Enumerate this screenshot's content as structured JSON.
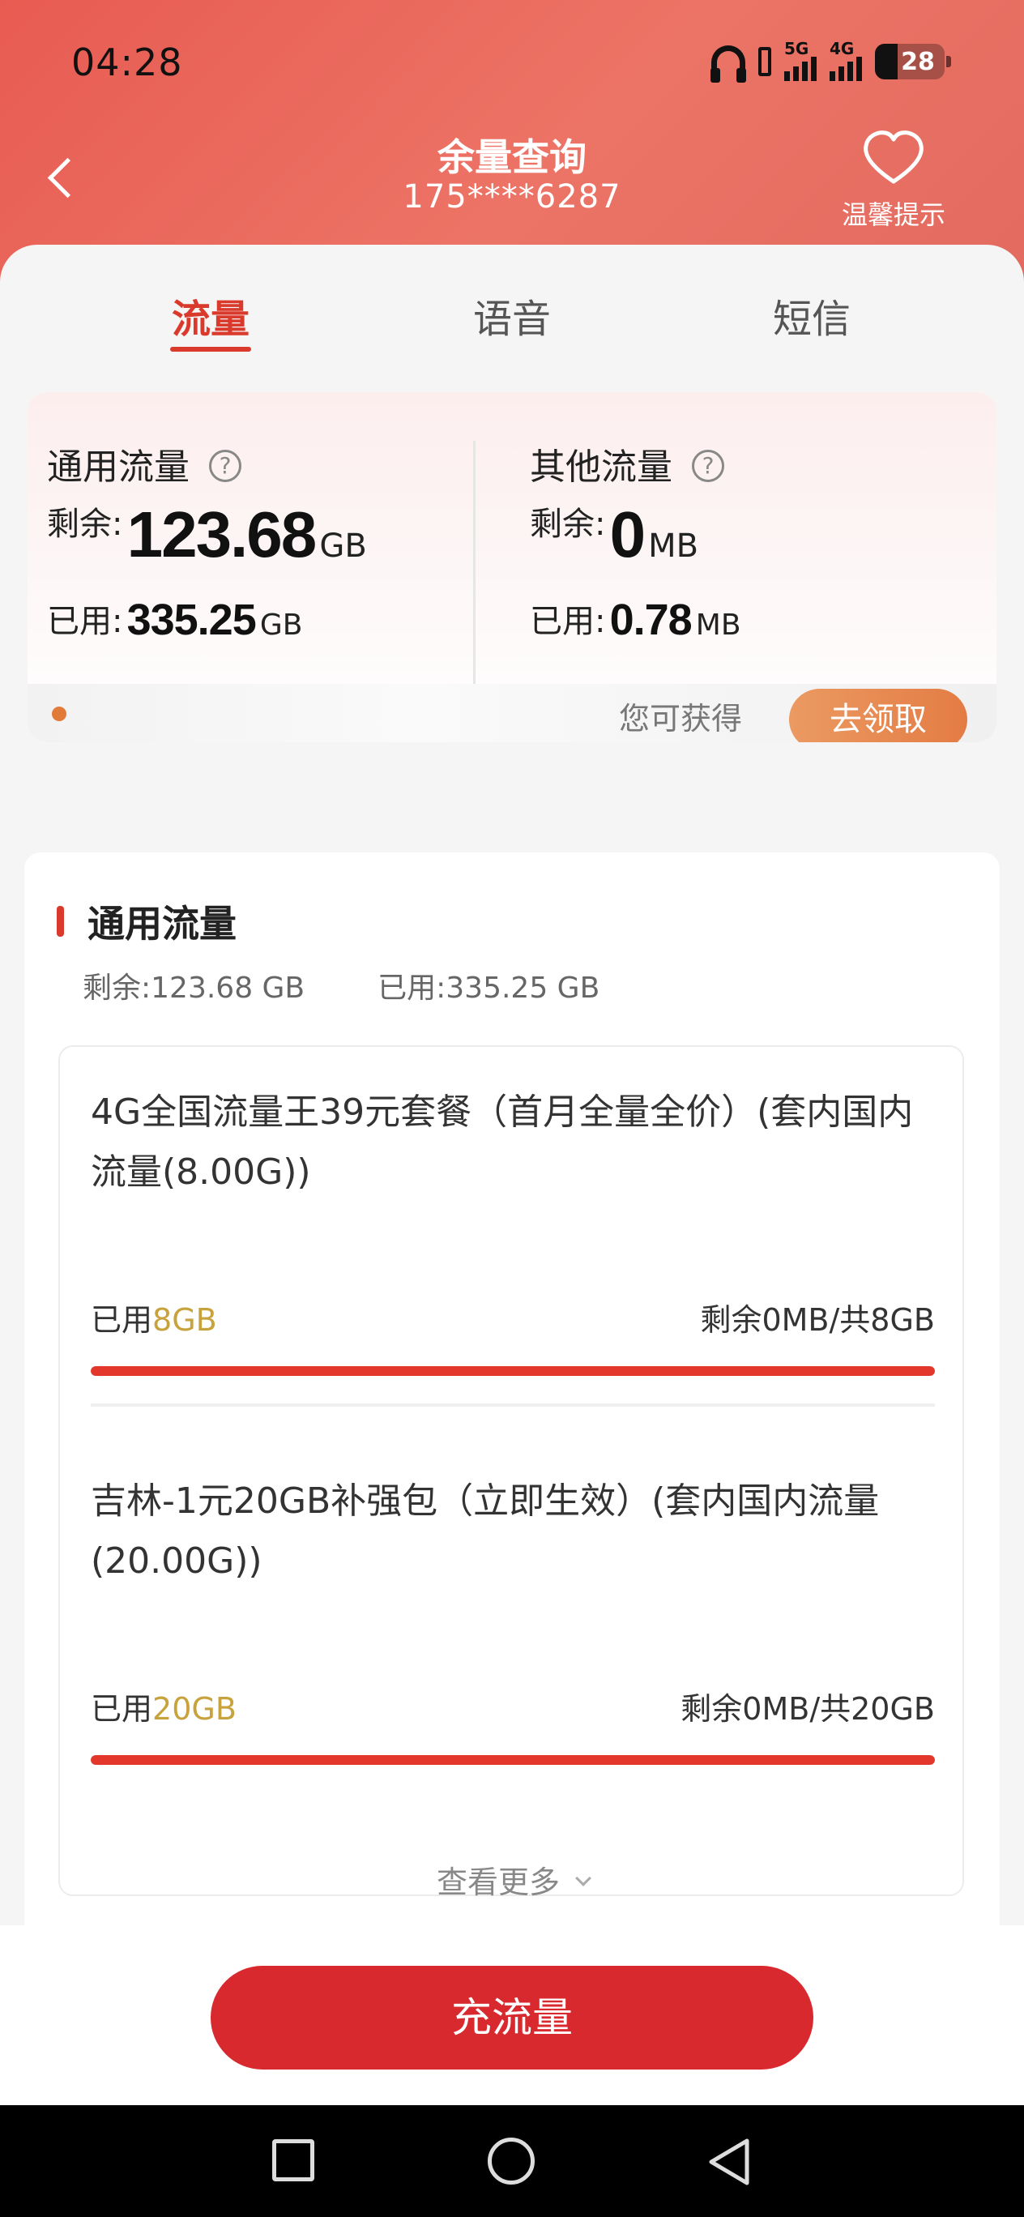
{
  "status_bar": {
    "time": "04:28",
    "net1": "5G",
    "net2": "4G",
    "battery": "28"
  },
  "header": {
    "title": "余量查询",
    "phone": "175****6287",
    "tips_label": "温馨提示"
  },
  "tabs": [
    {
      "label": "流量",
      "active": true
    },
    {
      "label": "语音"
    },
    {
      "label": "短信"
    }
  ],
  "summary": {
    "general": {
      "title": "通用流量",
      "remain_label": "剩余:",
      "remain_value": "123.68",
      "remain_unit": "GB",
      "used_label": "已用:",
      "used_value": "335.25",
      "used_unit": "GB"
    },
    "other": {
      "title": "其他流量",
      "remain_label": "剩余:",
      "remain_value": "0",
      "remain_unit": "MB",
      "used_label": "已用:",
      "used_value": "0.78",
      "used_unit": "MB"
    },
    "promo_text": "您可获得",
    "claim_label": "去领取"
  },
  "detail": {
    "title": "通用流量",
    "remain": "剩余:123.68 GB",
    "used": "已用:335.25 GB",
    "packages": [
      {
        "name": "4G全国流量王39元套餐（首月全量全价）(套内国内流量(8.00G))",
        "used_label": "已用",
        "used_value": "8GB",
        "remain_text": "剩余0MB/共8GB",
        "used_fraction": 1.0
      },
      {
        "name": "吉林-1元20GB补强包（立即生效）(套内国内流量(20.00G))",
        "used_label": "已用",
        "used_value": "20GB",
        "remain_text": "剩余0MB/共20GB",
        "used_fraction": 1.0
      }
    ],
    "see_more": "查看更多"
  },
  "recharge_label": "充流量",
  "colors": {
    "accent": "#d93a2b",
    "button": "#d82a2e",
    "used_highlight": "#c8a23c",
    "claim": "#e37c44"
  }
}
